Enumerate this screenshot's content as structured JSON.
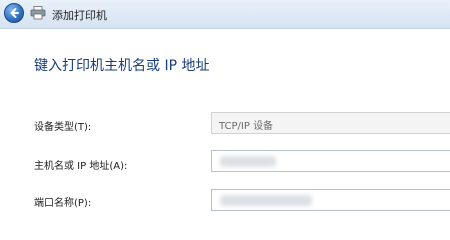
{
  "window": {
    "title": "添加打印机",
    "back_icon": "back-arrow-icon",
    "app_icon": "printer-icon"
  },
  "page": {
    "heading": "键入打印机主机名或 IP 地址"
  },
  "form": {
    "device_type": {
      "label": "设备类型(T):",
      "value": "TCP/IP 设备"
    },
    "hostname": {
      "label": "主机名或 IP 地址(A):",
      "value": ""
    },
    "port_name": {
      "label": "端口名称(P):",
      "value": ""
    }
  },
  "colors": {
    "heading": "#1a3d7c",
    "titlebar": "#dde8f5",
    "accent": "#2f6fc0"
  }
}
